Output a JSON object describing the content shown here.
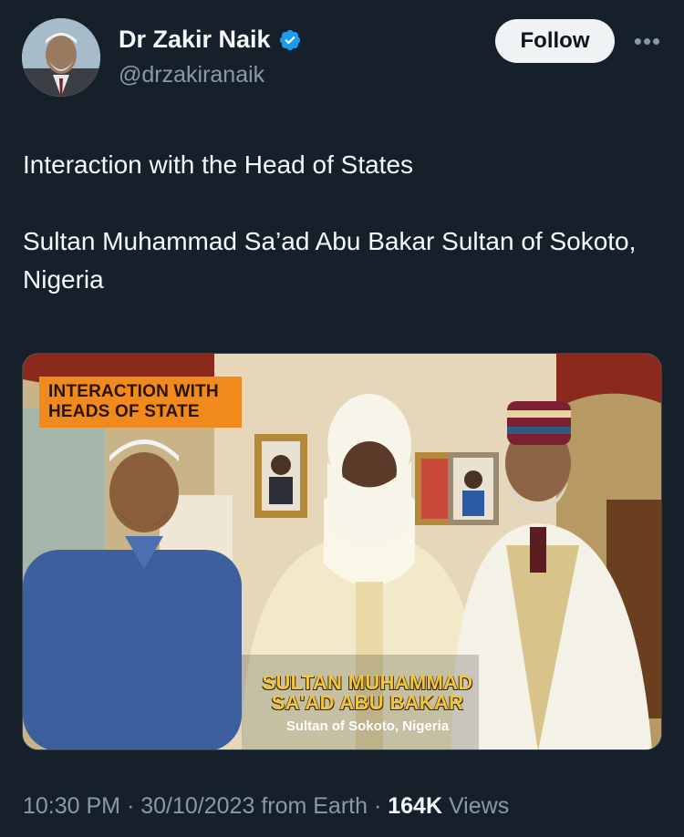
{
  "author": {
    "display_name": "Dr Zakir Naik",
    "handle": "@drzakiranaik",
    "verified": true,
    "avatar_icon": "profile-photo"
  },
  "actions": {
    "follow_label": "Follow",
    "more_label": "•••"
  },
  "tweet": {
    "line1": "Interaction with the Head of States",
    "line2": "Sultan Muhammad Sa’ad Abu Bakar Sultan of Sokoto, Nigeria"
  },
  "media": {
    "banner_line1": "INTERACTION WITH",
    "banner_line2": "HEADS OF STATE",
    "caption_line1": "SULTAN MUHAMMAD",
    "caption_line2": "SA'AD ABU BAKAR",
    "caption_sub": "Sultan of Sokoto, Nigeria"
  },
  "meta": {
    "time": "10:30 PM",
    "sep": " · ",
    "date": "30/10/2023",
    "source": "from Earth",
    "views_count": "164K",
    "views_label": "Views"
  },
  "colors": {
    "background": "#15202b",
    "accent": "#1d9bf0",
    "banner": "#f18a1c",
    "caption": "#f2c540"
  }
}
